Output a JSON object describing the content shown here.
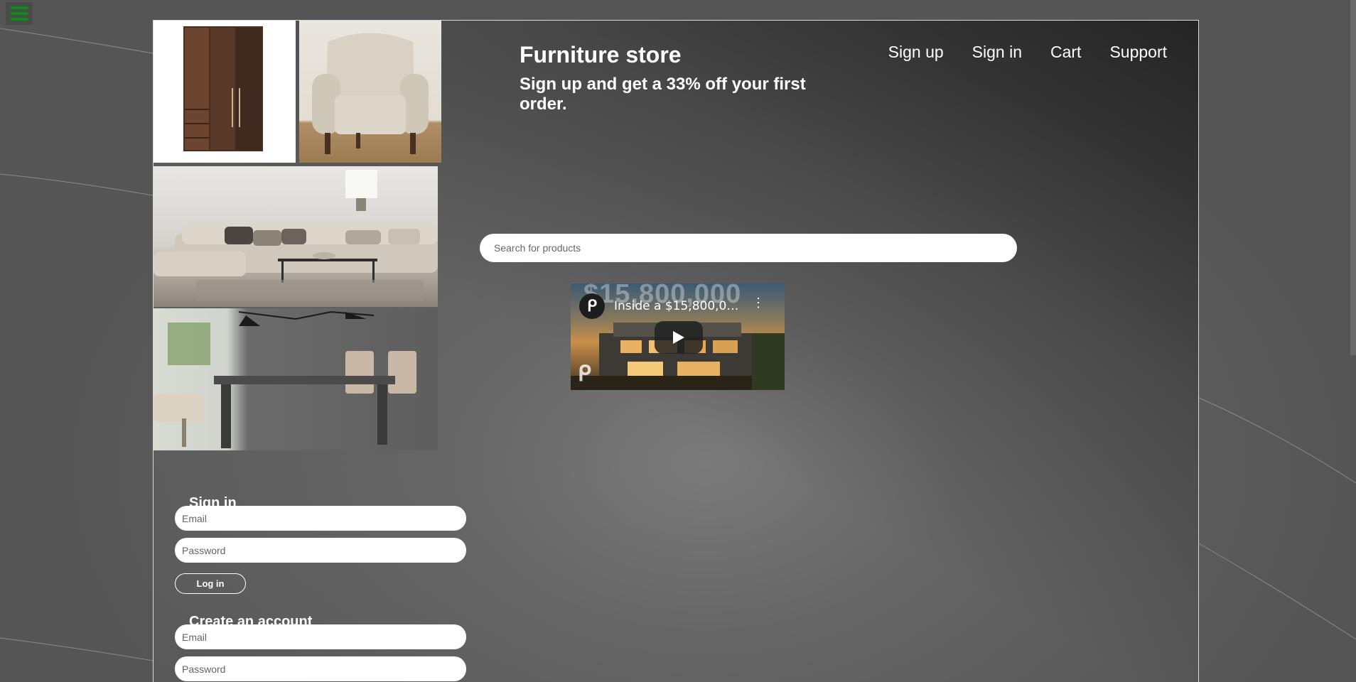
{
  "header": {
    "title": "Furniture store",
    "subtitle": "Sign up and get a 33% off your first order."
  },
  "nav": {
    "items": [
      {
        "label": "Sign up"
      },
      {
        "label": "Sign in"
      },
      {
        "label": "Cart"
      },
      {
        "label": "Support"
      }
    ]
  },
  "search": {
    "placeholder": "Search for products",
    "value": ""
  },
  "video": {
    "title": "Inside a $15,800,000...",
    "background_text": "$15,800,000",
    "channel_icon": "channel-logo-icon",
    "play_icon": "play-icon",
    "more_icon": "more-vertical-icon"
  },
  "sign_in": {
    "heading": "Sign in",
    "email_placeholder": "Email",
    "password_placeholder": "Password",
    "button_label": "Log in"
  },
  "create_account": {
    "heading": "Create an account",
    "email_placeholder": "Email",
    "password_placeholder": "Password"
  },
  "images": [
    {
      "name": "wardrobe-image"
    },
    {
      "name": "armchair-image"
    },
    {
      "name": "sofa-living-room-image"
    },
    {
      "name": "dining-table-image"
    }
  ],
  "colors": {
    "menu_icon": "#0d8a1a",
    "text": "#ffffff",
    "input_bg": "#ffffff"
  }
}
